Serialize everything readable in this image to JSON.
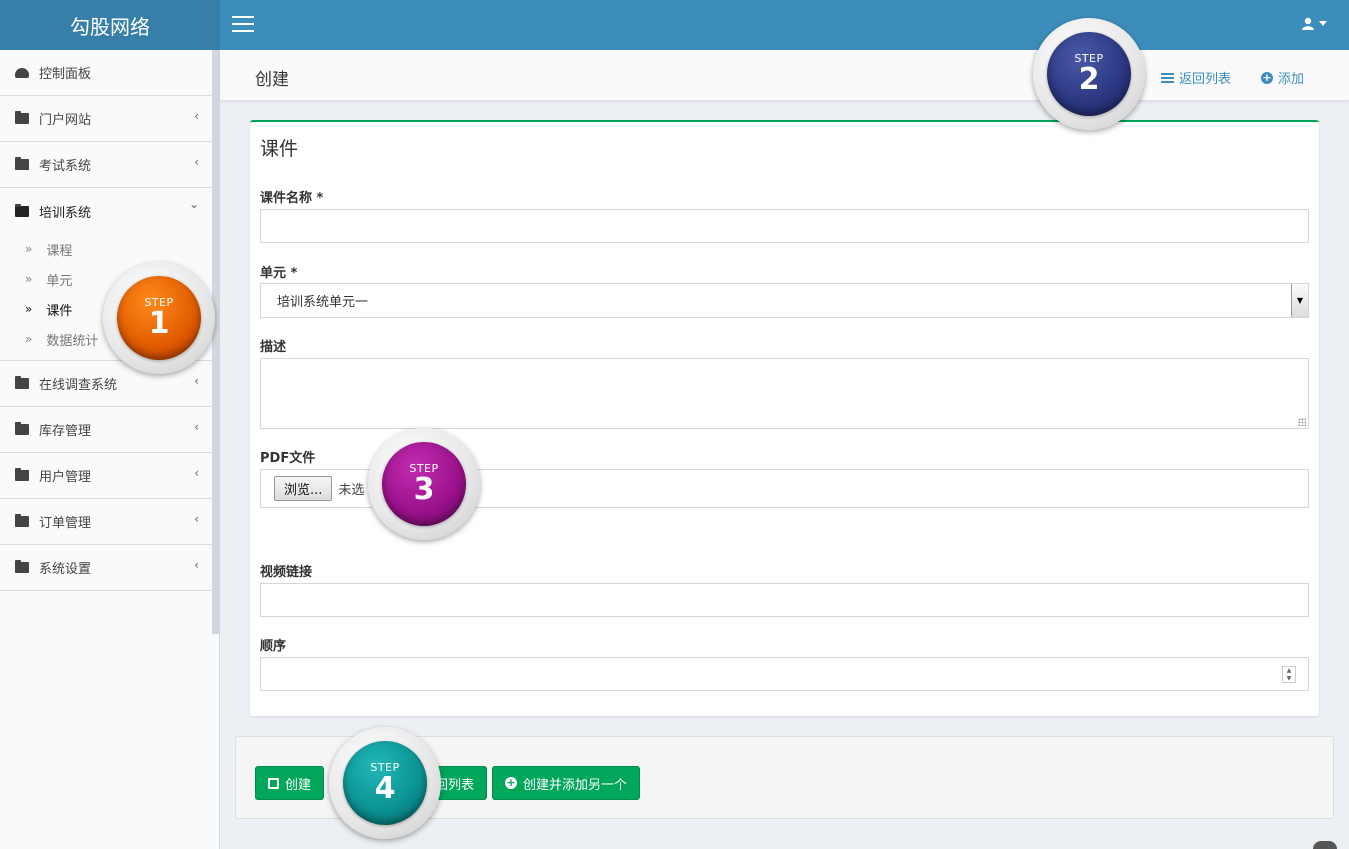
{
  "app": {
    "brand": "勾股网络"
  },
  "sidebar": {
    "items": [
      {
        "label": "控制面板",
        "icon": "dashboard-icon",
        "has_chevron": false
      },
      {
        "label": "门户网站",
        "icon": "folder-icon",
        "has_chevron": true
      },
      {
        "label": "考试系统",
        "icon": "folder-icon",
        "has_chevron": true
      },
      {
        "label": "培训系统",
        "icon": "folder-icon",
        "has_chevron": true,
        "open": true
      },
      {
        "label": "在线调查系统",
        "icon": "folder-icon",
        "has_chevron": true
      },
      {
        "label": "库存管理",
        "icon": "folder-icon",
        "has_chevron": true
      },
      {
        "label": "用户管理",
        "icon": "folder-icon",
        "has_chevron": true
      },
      {
        "label": "订单管理",
        "icon": "folder-icon",
        "has_chevron": true
      },
      {
        "label": "系统设置",
        "icon": "folder-icon",
        "has_chevron": true
      }
    ],
    "submenu": [
      {
        "label": "课程",
        "active": false
      },
      {
        "label": "单元",
        "active": false
      },
      {
        "label": "课件",
        "active": true
      },
      {
        "label": "数据统计",
        "active": false
      }
    ],
    "chevron_left": "‹",
    "chevron_down": "⌄",
    "sub_bullet": "»"
  },
  "header": {
    "title": "创建",
    "back_to_list": "返回列表",
    "add": "添加"
  },
  "form": {
    "box_title": "课件",
    "name_label": "课件名称 *",
    "name_value": "",
    "unit_label": "单元 *",
    "unit_value": "培训系统单元一",
    "desc_label": "描述",
    "desc_value": "",
    "pdf_label": "PDF文件",
    "browse_label": "浏览...",
    "no_file_text": "未选",
    "video_label": "视频链接",
    "video_value": "",
    "order_label": "顺序",
    "order_value": ""
  },
  "footer": {
    "create": "创建",
    "back_to_list_partial": "回列表",
    "create_and_add": "创建并添加另一个"
  },
  "steps": [
    {
      "word": "STEP",
      "num": "1",
      "color": "#e86a00"
    },
    {
      "word": "STEP",
      "num": "2",
      "color": "#2a3680"
    },
    {
      "word": "STEP",
      "num": "3",
      "color": "#98108a"
    },
    {
      "word": "STEP",
      "num": "4",
      "color": "#0a9090"
    }
  ],
  "colors": {
    "topbar": "#3c8dbc",
    "logo_bg": "#367fa9",
    "accent_green": "#00a65a",
    "link_blue": "#3c8dbc"
  }
}
